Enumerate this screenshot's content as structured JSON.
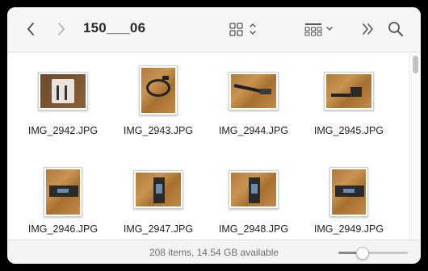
{
  "toolbar": {
    "back_icon": "chevron-left-icon",
    "forward_icon": "chevron-right-icon",
    "folder_title": "150___06",
    "view_icon": "grid-view-icon",
    "group_icon": "group-by-icon",
    "more_icon": "double-chevron-icon",
    "search_icon": "search-icon"
  },
  "files": [
    {
      "name": "IMG_2942.JPG"
    },
    {
      "name": "IMG_2943.JPG"
    },
    {
      "name": "IMG_2944.JPG"
    },
    {
      "name": "IMG_2945.JPG"
    },
    {
      "name": "IMG_2946.JPG"
    },
    {
      "name": "IMG_2947.JPG"
    },
    {
      "name": "IMG_2948.JPG"
    },
    {
      "name": "IMG_2949.JPG"
    }
  ],
  "status": {
    "text": "208 items, 14.54 GB available"
  },
  "zoom": {
    "level": 0.3
  },
  "colors": {
    "window_bg": "#ffffff",
    "toolbar_bg": "#f6f6f6",
    "wood": "#b67f3f"
  }
}
